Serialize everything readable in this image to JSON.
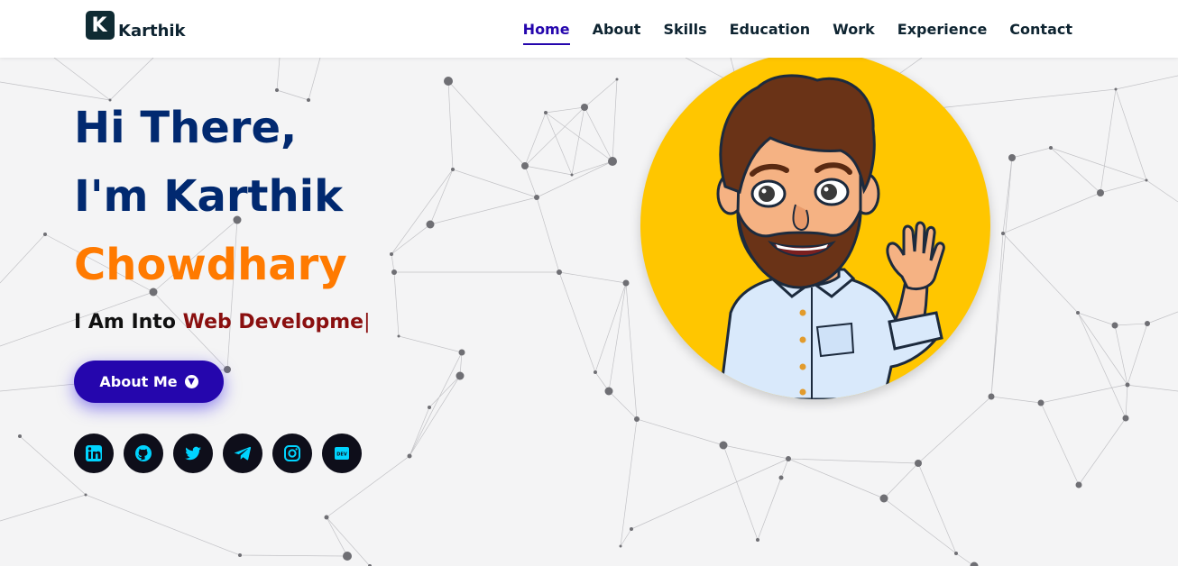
{
  "brand": {
    "logo_letter": "K",
    "name": "Karthik"
  },
  "nav": {
    "items": [
      {
        "label": "Home",
        "active": true
      },
      {
        "label": "About",
        "active": false
      },
      {
        "label": "Skills",
        "active": false
      },
      {
        "label": "Education",
        "active": false
      },
      {
        "label": "Work",
        "active": false
      },
      {
        "label": "Experience",
        "active": false
      },
      {
        "label": "Contact",
        "active": false
      }
    ]
  },
  "hero": {
    "greeting": "Hi There,",
    "intro": "I'm Karthik",
    "surname": "Chowdhary",
    "typing_prefix": "I Am Into ",
    "typing_text": "Web Developme",
    "cursor": "|",
    "cta_label": "About Me"
  },
  "socials": [
    {
      "icon": "linkedin-icon"
    },
    {
      "icon": "github-icon"
    },
    {
      "icon": "twitter-icon"
    },
    {
      "icon": "telegram-icon"
    },
    {
      "icon": "instagram-icon"
    },
    {
      "icon": "dev-icon",
      "text": "DEV"
    }
  ],
  "colors": {
    "navy": "#012970",
    "orange": "#ff7a00",
    "accent": "#2506ad",
    "typed": "#8a0f0f",
    "avatar_bg": "#ffc600",
    "social_icon": "#00d4ff"
  }
}
